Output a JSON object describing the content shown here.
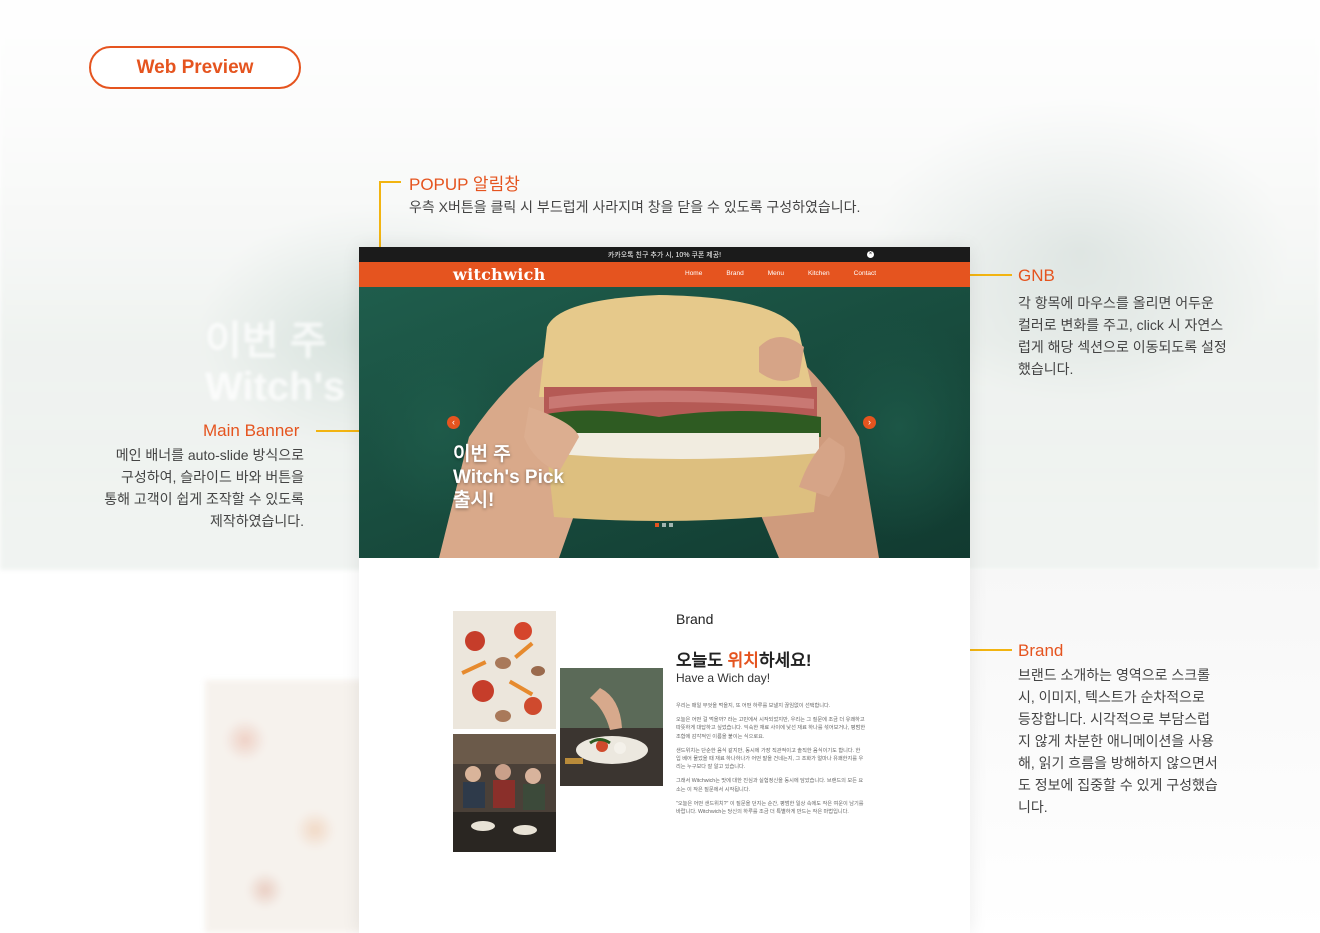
{
  "preview_label": "Web Preview",
  "backdrop_text": [
    "이번 주",
    "Witch's"
  ],
  "annotations": {
    "popup": {
      "title": "POPUP 알림창",
      "desc": "우측 X버튼을 클릭 시 부드럽게 사라지며 창을 닫을 수 있도록 구성하였습니다."
    },
    "gnb": {
      "title": "GNB",
      "lines": [
        "각 항목에 마우스를 올리면 어두운",
        "컬러로 변화를 주고, click 시 자연스",
        "럽게 해당 섹션으로 이동되도록 설정",
        "했습니다."
      ]
    },
    "banner": {
      "title": "Main Banner",
      "lines": [
        "메인 배너를 auto-slide 방식으로",
        "구성하여, 슬라이드 바와 버튼을",
        "통해 고객이 쉽게 조작할 수 있도록",
        "제작하였습니다."
      ]
    },
    "brand": {
      "title": "Brand",
      "lines": [
        "브랜드 소개하는 영역으로 스크롤",
        "시, 이미지, 텍스트가 순차적으로",
        "등장합니다. 시각적으로 부담스럽",
        "지 않게 차분한 애니메이션을 사용",
        "해, 읽기 흐름을 방해하지 않으면서",
        "도 정보에 집중할 수 있게 구성했습",
        "니다."
      ]
    }
  },
  "site": {
    "popup_text": "카카오톡 친구 추가 시, 10% 쿠폰 제공!",
    "popup_close": "×",
    "logo": "witchwich",
    "menu": [
      "Home",
      "Brand",
      "Menu",
      "Kitchen",
      "Contact"
    ],
    "banner": {
      "line1": "이번 주",
      "line2": "Witch's Pick",
      "line3": "출시!",
      "prev": "‹",
      "next": "›",
      "slide_count": 3,
      "active_slide": 1
    },
    "brand": {
      "label": "Brand",
      "head_pre": "오늘도 ",
      "head_hl": "위치",
      "head_post": "하세요!",
      "sub": "Have a Wich day!",
      "body": [
        "우리는 매일 무엇을 먹을지, 또 어떤 하루를 보낼지 끊임없이 선택합니다.",
        "오늘은 어떤 걸 먹을까? 라는 고민에서 시작되었지만, 우리는 그 질문에 조금 더 유쾌하고 따뜻하게 대답하고 싶었습니다. 익숙한 재료 사이에 낯선 재료 하나를 섞어보거나, 평범한 조합에 감각적인 이름을 붙이는 식으로요.",
        "샌드위치는 단순한 음식 같지만, 동시에 가장 직관적이고 솔직한 음식이기도 합니다. 한 입 베어 물었을 때 재료 하나하나가 어떤 말을 건네는지, 그 조화가 얼마나 유쾌한지를 우리는 누구보다 잘 알고 있습니다.",
        "그래서 Witchwich는 맛에 대한 진심과 실험정신을 동시에 담았습니다. 브랜드의 모든 요소는 이 작은 질문에서 시작됩니다.",
        "\"오늘은 어떤 샌드위치?\" 이 질문을 던지는 순간, 평범한 일상 속에도 작은 여운이 남기를 바랍니다. Witchwich는 당신의 하루를 조금 더 특별하게 만드는 작은 마법입니다."
      ]
    }
  }
}
